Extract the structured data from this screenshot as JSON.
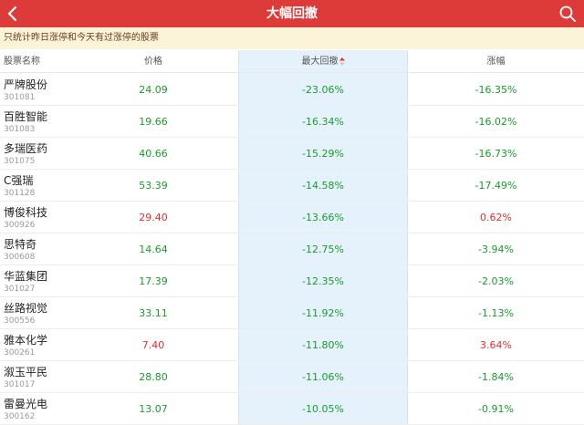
{
  "header": {
    "title": "大幅回撤",
    "back_icon": "chevron-left-icon",
    "search_icon": "search-icon"
  },
  "notice": "只统计昨日涨停和今天有过涨停的股票",
  "table": {
    "columns": {
      "name": "股票名称",
      "price": "价格",
      "drawdown": "最大回撤",
      "change": "涨幅"
    },
    "sort_column": "drawdown",
    "colors": {
      "up": "#e0312f",
      "down": "#1b9a2c",
      "highlight": "#e6f2fb"
    },
    "rows": [
      {
        "name": "严牌股份",
        "code": "301081",
        "price": "24.09",
        "price_dir": "down",
        "drawdown": "-23.06%",
        "change": "-16.35%",
        "change_dir": "down"
      },
      {
        "name": "百胜智能",
        "code": "301083",
        "price": "19.66",
        "price_dir": "down",
        "drawdown": "-16.34%",
        "change": "-16.02%",
        "change_dir": "down"
      },
      {
        "name": "多瑞医药",
        "code": "301075",
        "price": "40.66",
        "price_dir": "down",
        "drawdown": "-15.29%",
        "change": "-16.73%",
        "change_dir": "down"
      },
      {
        "name": "C强瑞",
        "code": "301128",
        "price": "53.39",
        "price_dir": "down",
        "drawdown": "-14.58%",
        "change": "-17.49%",
        "change_dir": "down"
      },
      {
        "name": "博俊科技",
        "code": "300926",
        "price": "29.40",
        "price_dir": "up",
        "drawdown": "-13.66%",
        "change": "0.62%",
        "change_dir": "up"
      },
      {
        "name": "思特奇",
        "code": "300608",
        "price": "14.64",
        "price_dir": "down",
        "drawdown": "-12.75%",
        "change": "-3.94%",
        "change_dir": "down"
      },
      {
        "name": "华蓝集团",
        "code": "301027",
        "price": "17.39",
        "price_dir": "down",
        "drawdown": "-12.35%",
        "change": "-2.03%",
        "change_dir": "down"
      },
      {
        "name": "丝路视觉",
        "code": "300556",
        "price": "33.11",
        "price_dir": "down",
        "drawdown": "-11.92%",
        "change": "-1.13%",
        "change_dir": "down"
      },
      {
        "name": "雅本化学",
        "code": "300261",
        "price": "7.40",
        "price_dir": "up",
        "drawdown": "-11.80%",
        "change": "3.64%",
        "change_dir": "up"
      },
      {
        "name": "溆玉平民",
        "code": "301017",
        "price": "28.80",
        "price_dir": "down",
        "drawdown": "-11.06%",
        "change": "-1.84%",
        "change_dir": "down"
      },
      {
        "name": "雷曼光电",
        "code": "300162",
        "price": "13.07",
        "price_dir": "down",
        "drawdown": "-10.05%",
        "change": "-0.91%",
        "change_dir": "down"
      }
    ]
  }
}
